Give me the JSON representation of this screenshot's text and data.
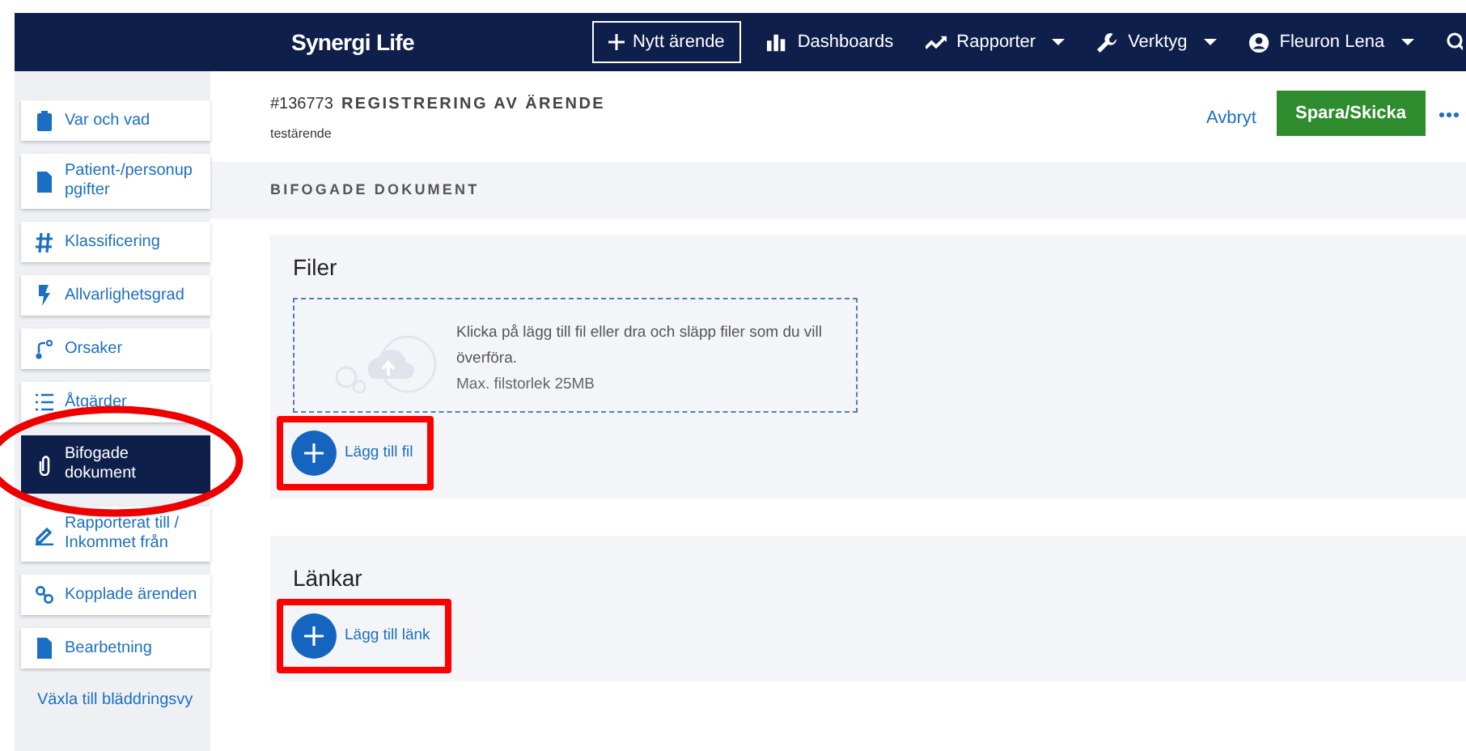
{
  "navbar": {
    "logo": "Synergi Life",
    "new_button": "Nytt ärende",
    "items": [
      {
        "label": "Dashboards",
        "kind": "chart",
        "dropdown": false
      },
      {
        "label": "Rapporter",
        "kind": "trend",
        "dropdown": true
      },
      {
        "label": "Verktyg",
        "kind": "wrench",
        "dropdown": true
      },
      {
        "label": "Fleuron Lena",
        "kind": "user",
        "dropdown": true
      }
    ]
  },
  "sidebar": {
    "items": [
      {
        "label": "Var och vad",
        "selected": false,
        "highlighted": false
      },
      {
        "label": "Patient-/personup pgifter",
        "selected": false,
        "highlighted": false
      },
      {
        "label": "Klassificering",
        "selected": false,
        "highlighted": false
      },
      {
        "label": "Allvarlighetsgrad",
        "selected": false,
        "highlighted": false
      },
      {
        "label": "Orsaker",
        "selected": false,
        "highlighted": false
      },
      {
        "label": "Åtgärder",
        "selected": false,
        "highlighted": false
      },
      {
        "label": "Bifogade dokument",
        "selected": true,
        "highlighted": true
      },
      {
        "label": "Rapporterat till / Inkommet från",
        "selected": false,
        "highlighted": false
      },
      {
        "label": "Kopplade ärenden",
        "selected": false,
        "highlighted": false
      },
      {
        "label": "Bearbetning",
        "selected": false,
        "highlighted": false
      }
    ],
    "footer_link": "Växla till bläddringsvy"
  },
  "header": {
    "number": "#136773",
    "title": "REGISTRERING AV ÄRENDE",
    "subtitle": "testärende",
    "cancel": "Avbryt",
    "save": "Spara/Skicka"
  },
  "section_title": "BIFOGADE DOKUMENT",
  "cards": [
    {
      "title": "Filer",
      "dropzone": {
        "text": "Klicka på lägg till fil eller dra och släpp filer som du vill överföra.",
        "limit": "Max. filstorlek 25MB"
      },
      "button": "Lägg till fil",
      "highlighted": true
    },
    {
      "title": "Länkar",
      "button": "Lägg till länk",
      "highlighted": true
    }
  ]
}
